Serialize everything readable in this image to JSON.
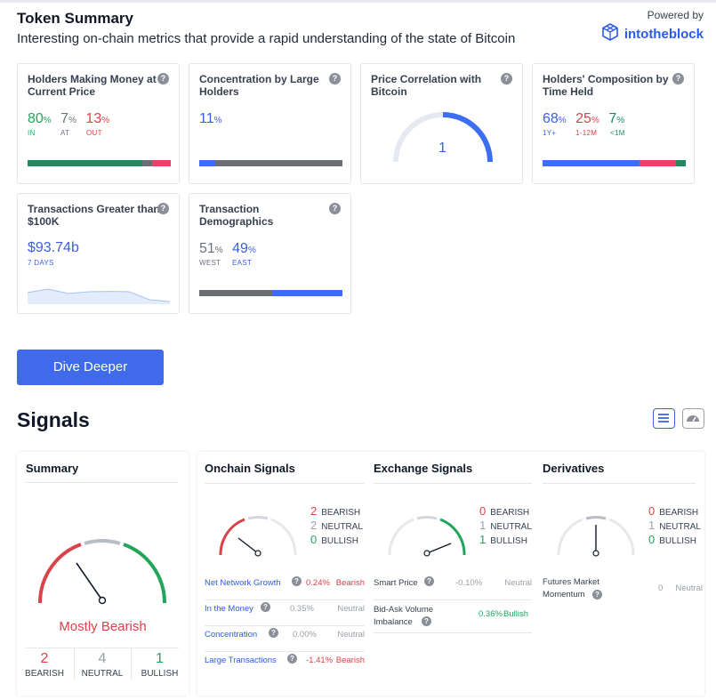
{
  "header": {
    "title": "Token Summary",
    "subtitle": "Interesting on-chain metrics that provide a rapid understanding of the state of Bitcoin",
    "powered_by": "Powered by",
    "brand": "intotheblock"
  },
  "colors": {
    "accent": "#3f6ae9",
    "green": "#22a55b",
    "red": "#d9434a",
    "blue": "#3b5ee8",
    "gray": "#6b6e72"
  },
  "cards": {
    "holders_money": {
      "title": "Holders Making Money at Current Price",
      "in_value": "80",
      "in_label": "IN",
      "at_value": "7",
      "at_label": "AT",
      "out_value": "13",
      "out_label": "OUT",
      "pct": "%",
      "bar": [
        80,
        7,
        13
      ]
    },
    "concentration": {
      "title": "Concentration by Large Holders",
      "value": "11",
      "pct": "%",
      "bar": [
        11,
        89
      ]
    },
    "price_correlation": {
      "title": "Price Correlation with Bitcoin",
      "value": "1"
    },
    "composition": {
      "title": "Holders' Composition by Time Held",
      "v1": "68",
      "l1": "1Y+",
      "v2": "25",
      "l2": "1-12M",
      "v3": "7",
      "l3": "<1M",
      "pct": "%",
      "bar": [
        68,
        25,
        7
      ]
    },
    "transactions": {
      "title": "Transactions Greater than $100K",
      "value": "$93.74b",
      "period": "7 DAYS",
      "sparkline": [
        0.55,
        0.75,
        0.5,
        0.6,
        0.62,
        0.6,
        0.15,
        0.05
      ]
    },
    "demographics": {
      "title": "Transaction Demographics",
      "west_value": "51",
      "west_label": "WEST",
      "east_value": "49",
      "east_label": "EAST",
      "pct": "%",
      "bar": [
        51,
        49
      ]
    }
  },
  "dive_button": "Dive Deeper",
  "signals": {
    "title": "Signals",
    "summary": {
      "title": "Summary",
      "verdict": "Mostly Bearish",
      "bearish_count": "2",
      "bearish_label": "BEARISH",
      "neutral_count": "4",
      "neutral_label": "NEUTRAL",
      "bullish_count": "1",
      "bullish_label": "BULLISH"
    },
    "onchain": {
      "title": "Onchain Signals",
      "bearish": "2",
      "neutral": "2",
      "bullish": "0",
      "bearish_label": "BEARISH",
      "neutral_label": "NEUTRAL",
      "bullish_label": "BULLISH",
      "rows": [
        {
          "name": "Net Network Growth",
          "value": "0.24%",
          "status": "Bearish"
        },
        {
          "name": "In the Money",
          "value": "0.35%",
          "status": "Neutral"
        },
        {
          "name": "Concentration",
          "value": "0.00%",
          "status": "Neutral"
        },
        {
          "name": "Large Transactions",
          "value": "-1.41%",
          "status": "Bearish"
        }
      ]
    },
    "exchange": {
      "title": "Exchange Signals",
      "bearish": "0",
      "neutral": "1",
      "bullish": "1",
      "bearish_label": "BEARISH",
      "neutral_label": "NEUTRAL",
      "bullish_label": "BULLISH",
      "rows": [
        {
          "name": "Smart Price",
          "value": "-0.10%",
          "status": "Neutral"
        },
        {
          "name": "Bid-Ask Volume Imbalance",
          "value": "0.36%",
          "status": "Bullish"
        }
      ]
    },
    "derivatives": {
      "title": "Derivatives",
      "bearish": "0",
      "neutral": "1",
      "bullish": "0",
      "bearish_label": "BEARISH",
      "neutral_label": "NEUTRAL",
      "bullish_label": "BULLISH",
      "rows": [
        {
          "name": "Futures Market Momentum",
          "value": "0",
          "status": "Neutral"
        }
      ]
    }
  }
}
